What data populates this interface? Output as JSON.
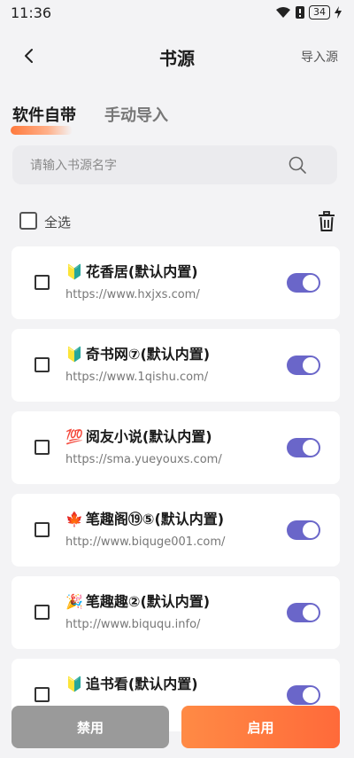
{
  "status": {
    "time": "11:36",
    "battery": "34"
  },
  "header": {
    "title": "书源",
    "import_label": "导入源"
  },
  "tabs": [
    {
      "label": "软件自带",
      "active": true
    },
    {
      "label": "手动导入",
      "active": false
    }
  ],
  "search": {
    "placeholder": "请输入书源名字",
    "value": ""
  },
  "select_all": {
    "label": "全选",
    "checked": false
  },
  "sources": [
    {
      "emoji": "🔰",
      "name": "花香居(默认内置)",
      "url": "https://www.hxjxs.com/",
      "enabled": true,
      "checked": false
    },
    {
      "emoji": "🔰",
      "name": "奇书网⑦(默认内置)",
      "url": "https://www.1qishu.com/",
      "enabled": true,
      "checked": false
    },
    {
      "emoji": "💯",
      "name": "阅友小说(默认内置)",
      "url": "https://sma.yueyouxs.com/",
      "enabled": true,
      "checked": false
    },
    {
      "emoji": "🍁",
      "name": "笔趣阁⑲⑤(默认内置)",
      "url": "http://www.biquge001.com/",
      "enabled": true,
      "checked": false
    },
    {
      "emoji": "🎉",
      "name": "笔趣趣②(默认内置)",
      "url": "http://www.biququ.info/",
      "enabled": true,
      "checked": false
    },
    {
      "emoji": "🔰",
      "name": "追书看(默认内置)",
      "url": "",
      "enabled": true,
      "checked": false
    }
  ],
  "buttons": {
    "disable_label": "禁用",
    "enable_label": "启用"
  },
  "colors": {
    "accent": "#ff7a3d",
    "toggle_on": "#6a66c9",
    "disable_btn": "#9a9a9a"
  }
}
